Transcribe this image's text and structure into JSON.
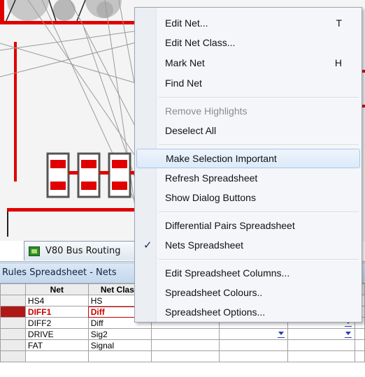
{
  "context_menu": {
    "items": [
      {
        "label": "Edit Net...",
        "shortcut": "T"
      },
      {
        "label": "Edit Net Class...",
        "shortcut": ""
      },
      {
        "label": "Mark Net",
        "shortcut": "H"
      },
      {
        "label": "Find Net",
        "shortcut": ""
      },
      {
        "label": "Remove Highlights",
        "shortcut": "",
        "disabled": true
      },
      {
        "label": "Deselect All",
        "shortcut": ""
      },
      {
        "label": "Make Selection Important",
        "shortcut": "",
        "highlighted": true
      },
      {
        "label": "Refresh Spreadsheet",
        "shortcut": ""
      },
      {
        "label": "Show Dialog Buttons",
        "shortcut": ""
      },
      {
        "label": "Differential Pairs Spreadsheet",
        "shortcut": ""
      },
      {
        "label": "Nets Spreadsheet",
        "shortcut": "",
        "checked": true
      },
      {
        "label": "Edit Spreadsheet Columns...",
        "shortcut": ""
      },
      {
        "label": "Spreadsheet Colours..",
        "shortcut": ""
      },
      {
        "label": "Spreadsheet Options...",
        "shortcut": ""
      }
    ],
    "check_mark": "✓"
  },
  "document_tab": {
    "label": "V80 Bus Routing"
  },
  "panel": {
    "title": "Rules Spreadsheet - Nets"
  },
  "spreadsheet": {
    "columns": [
      "Net",
      "Net Class"
    ],
    "rows": [
      {
        "net": "HS4",
        "net_class": "HS",
        "selected": false,
        "dropdowns": []
      },
      {
        "net": "DIFF1",
        "net_class": "Diff",
        "selected": true,
        "dropdowns": []
      },
      {
        "net": "DIFF2",
        "net_class": "Diff",
        "selected": false,
        "dropdowns": [
          5
        ]
      },
      {
        "net": "DRIVE",
        "net_class": "Sig2",
        "selected": false,
        "dropdowns": [
          4,
          5
        ]
      },
      {
        "net": "FAT",
        "net_class": "Signal",
        "selected": false,
        "dropdowns": []
      }
    ]
  },
  "colors": {
    "trace_red": "#e00000",
    "selection_red": "#cc0000",
    "menu_highlight": "#dceafa",
    "panel_header": "#c4d7ec"
  }
}
